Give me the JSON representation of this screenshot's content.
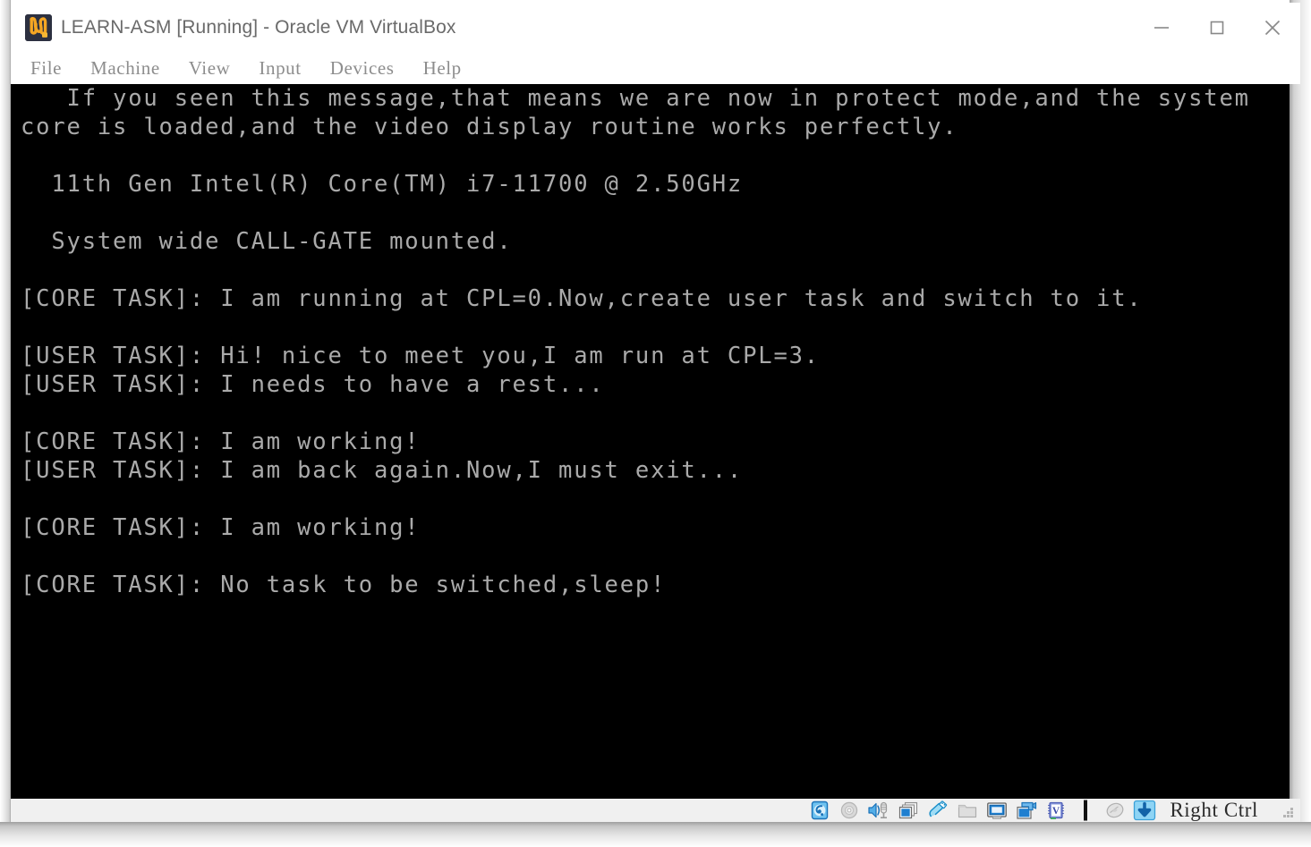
{
  "window": {
    "title": "LEARN-ASM [Running] - Oracle VM VirtualBox",
    "logo_icon": "virtualbox-logo-icon",
    "controls": {
      "minimize_icon": "minimize-icon",
      "maximize_icon": "maximize-icon",
      "close_icon": "close-icon"
    }
  },
  "menubar": {
    "items": [
      {
        "label": "File"
      },
      {
        "label": "Machine"
      },
      {
        "label": "View"
      },
      {
        "label": "Input"
      },
      {
        "label": "Devices"
      },
      {
        "label": "Help"
      }
    ]
  },
  "terminal": {
    "background_color": "#000000",
    "text_color": "#aaaaaa",
    "lines": [
      "   If you seen this message,that means we are now in protect mode,and the system",
      "core is loaded,and the video display routine works perfectly.",
      "",
      "  11th Gen Intel(R) Core(TM) i7-11700 @ 2.50GHz",
      "",
      "  System wide CALL-GATE mounted.",
      "",
      "[CORE TASK]: I am running at CPL=0.Now,create user task and switch to it.",
      "",
      "[USER TASK]: Hi! nice to meet you,I am run at CPL=3.",
      "[USER TASK]: I needs to have a rest...",
      "",
      "[CORE TASK]: I am working!",
      "[USER TASK]: I am back again.Now,I must exit...",
      "",
      "[CORE TASK]: I am working!",
      "",
      "[CORE TASK]: No task to be switched,sleep!"
    ]
  },
  "statusbar": {
    "icons": [
      {
        "name": "hard-disk-icon",
        "active": true
      },
      {
        "name": "optical-disk-icon",
        "active": false
      },
      {
        "name": "audio-icon",
        "active": true
      },
      {
        "name": "network-icon",
        "active": true
      },
      {
        "name": "usb-icon",
        "active": true
      },
      {
        "name": "shared-folders-icon",
        "active": false
      },
      {
        "name": "display-icon",
        "active": true
      },
      {
        "name": "video-capture-icon",
        "active": true
      },
      {
        "name": "virtualization-icon",
        "active": true
      },
      {
        "name": "mouse-integration-icon",
        "active": false
      },
      {
        "name": "host-key-icon",
        "active": true
      }
    ],
    "host_key_label": "Right Ctrl",
    "resize_grip_icon": "resize-grip-icon"
  }
}
